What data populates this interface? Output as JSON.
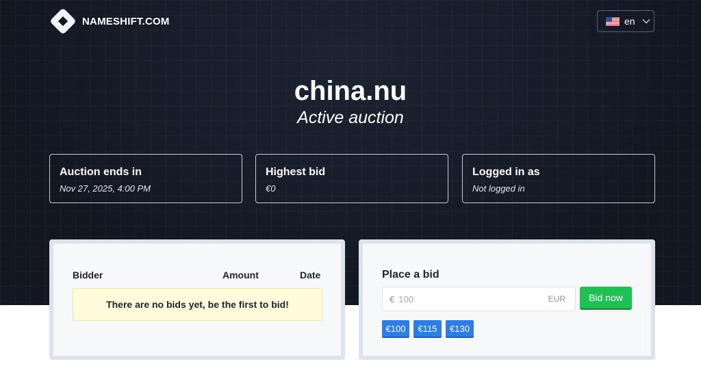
{
  "header": {
    "brand": "NAMESHIFT.COM",
    "language": {
      "label": "en",
      "flag_icon": "us-flag-icon"
    }
  },
  "hero": {
    "domain": "china.nu",
    "status": "Active auction"
  },
  "info_cards": [
    {
      "label": "Auction ends in",
      "value": "Nov 27, 2025, 4:00 PM"
    },
    {
      "label": "Highest bid",
      "value": "€0"
    },
    {
      "label": "Logged in as",
      "value": "Not logged in"
    }
  ],
  "bids_table": {
    "columns": [
      "Bidder",
      "Amount",
      "Date"
    ],
    "empty_message": "There are no bids yet, be the first to bid!"
  },
  "bid_form": {
    "title": "Place a bid",
    "currency_symbol": "€",
    "placeholder": "100",
    "unit": "EUR",
    "submit_label": "Bid now",
    "quick_bids": [
      "€100",
      "€115",
      "€130"
    ]
  },
  "colors": {
    "hero_bg": "#141a25",
    "bid_button": "#21c054",
    "quick_bid": "#2f7de1",
    "empty_notice_bg": "#fffbdb"
  }
}
